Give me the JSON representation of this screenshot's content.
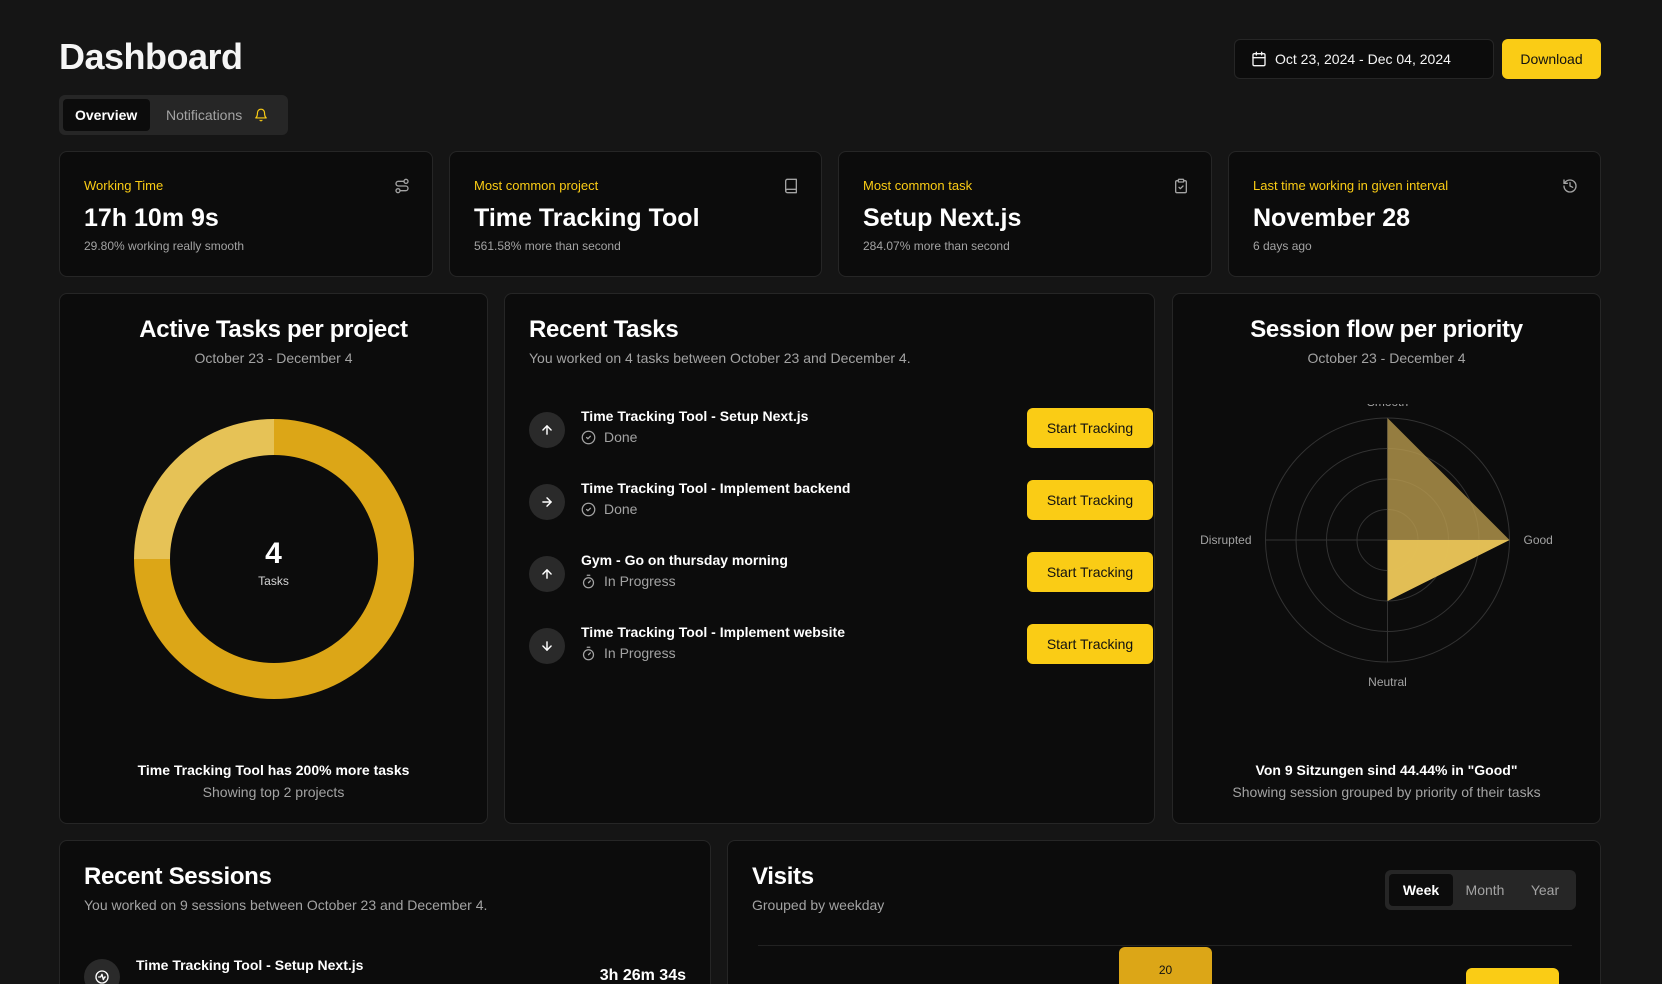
{
  "header": {
    "title": "Dashboard",
    "tabs": [
      {
        "label": "Overview",
        "active": true
      },
      {
        "label": "Notifications",
        "active": false
      }
    ],
    "date_range": "Oct 23, 2024 - Dec 04, 2024",
    "download_label": "Download"
  },
  "colors": {
    "accent": "#facc15",
    "accent_dark": "#dca617",
    "accent_light": "#e6c256",
    "background": "#151515",
    "card": "#0c0c0c"
  },
  "stats": [
    {
      "label": "Working Time",
      "value": "17h 10m 9s",
      "sub": "29.80% working really smooth",
      "icon": "route-icon"
    },
    {
      "label": "Most common project",
      "value": "Time Tracking Tool",
      "sub": "561.58% more than second",
      "icon": "book-icon"
    },
    {
      "label": "Most common task",
      "value": "Setup Next.js",
      "sub": "284.07% more than second",
      "icon": "clipboard-check-icon"
    },
    {
      "label": "Last time working in given interval",
      "value": "November 28",
      "sub": "6 days ago",
      "icon": "history-icon"
    }
  ],
  "active_tasks": {
    "title": "Active Tasks per project",
    "subtitle": "October 23 - December 4",
    "center_value": "4",
    "center_label": "Tasks",
    "footer_strong": "Time Tracking Tool has 200% more tasks",
    "footer_muted": "Showing top 2 projects"
  },
  "recent_tasks": {
    "title": "Recent Tasks",
    "subtitle": "You worked on 4 tasks between October 23 and December 4.",
    "button_label": "Start Tracking",
    "items": [
      {
        "title": "Time Tracking Tool - Setup Next.js",
        "status": "Done",
        "priority_icon": "arrow-up-icon"
      },
      {
        "title": "Time Tracking Tool - Implement backend",
        "status": "Done",
        "priority_icon": "arrow-right-icon"
      },
      {
        "title": "Gym - Go on thursday morning",
        "status": "In Progress",
        "priority_icon": "arrow-up-icon"
      },
      {
        "title": "Time Tracking Tool - Implement website",
        "status": "In Progress",
        "priority_icon": "arrow-down-icon"
      }
    ]
  },
  "session_flow": {
    "title": "Session flow per priority",
    "subtitle": "October 23 - December 4",
    "footer_strong": "Von 9 Sitzungen sind 44.44% in \"Good\"",
    "footer_muted": "Showing session grouped by priority of their tasks"
  },
  "recent_sessions": {
    "title": "Recent Sessions",
    "subtitle": "You worked on 9 sessions between October 23 and December 4.",
    "items": [
      {
        "title": "Time Tracking Tool - Setup Next.js",
        "duration": "3h 26m 34s"
      }
    ]
  },
  "visits": {
    "title": "Visits",
    "subtitle": "Grouped by weekday",
    "ranges": [
      "Week",
      "Month",
      "Year"
    ],
    "active_range": "Week"
  },
  "chart_data": [
    {
      "type": "pie",
      "title": "Active Tasks per project",
      "categories": [
        "Time Tracking Tool",
        "Gym"
      ],
      "values": [
        3,
        1
      ]
    },
    {
      "type": "radar",
      "title": "Session flow per priority",
      "categories": [
        "Smooth",
        "Good",
        "Neutral",
        "Disrupted"
      ],
      "series": [
        {
          "values": [
            2,
            2,
            1,
            0
          ]
        },
        {
          "values": [
            0,
            2,
            1,
            0
          ]
        }
      ],
      "rlim": [
        0,
        2
      ]
    },
    {
      "type": "bar",
      "title": "Visits",
      "data_labels": [
        "20"
      ]
    }
  ]
}
